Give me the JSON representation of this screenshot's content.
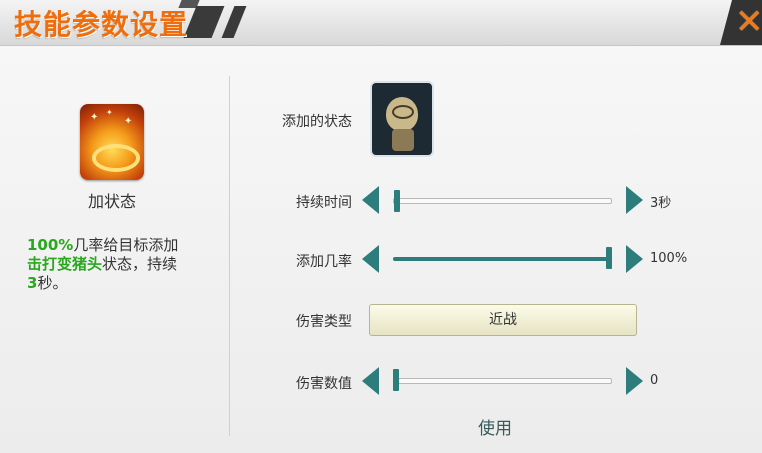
{
  "window": {
    "title": "技能参数设置",
    "close_label": "✕"
  },
  "skill": {
    "name": "加状态",
    "description_parts": [
      {
        "text": "100%",
        "highlight": true
      },
      {
        "text": "几率给目标添加",
        "highlight": false
      },
      {
        "text": "击打变猪头",
        "highlight": true
      },
      {
        "text": "状态，持续",
        "highlight": false
      },
      {
        "text": "3",
        "highlight": true
      },
      {
        "text": "秒。",
        "highlight": false
      }
    ]
  },
  "params": {
    "added_state_label": "添加的状态",
    "duration": {
      "label": "持续时间",
      "value_text": "3秒",
      "level": 0.0
    },
    "chance": {
      "label": "添加几率",
      "value_text": "100%",
      "level": 1.0
    },
    "damage_type": {
      "label": "伤害类型",
      "value": "近战"
    },
    "damage_value": {
      "label": "伤害数值",
      "value_text": "0",
      "level": 0.0
    }
  },
  "actions": {
    "use_label": "使用"
  },
  "colors": {
    "accent": "#2c7d7c",
    "title": "#ef6d0c",
    "highlight": "#2aa71f"
  }
}
